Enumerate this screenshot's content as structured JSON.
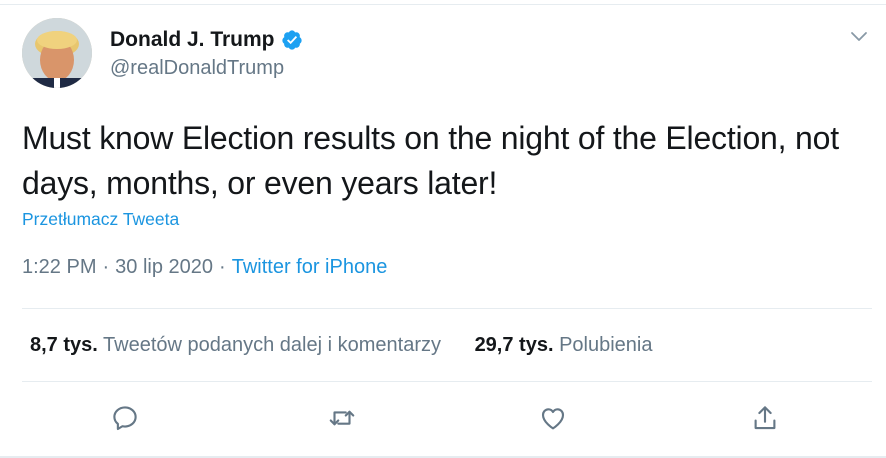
{
  "tweet": {
    "author_name": "Donald J. Trump",
    "author_handle": "@realDonaldTrump",
    "text": "Must know Election results on the night of the Election, not days, months, or even years later!",
    "translate_label": "Przetłumacz Tweeta",
    "time": "1:22 PM",
    "date": "30 lip 2020",
    "separator": "·",
    "source": "Twitter for iPhone",
    "retweets_count": "8,7 tys.",
    "retweets_label": "Tweetów podanych dalej i komentarzy",
    "likes_count": "29,7 tys.",
    "likes_label": "Polubienia"
  },
  "icons": {
    "verified": "verified-badge-icon",
    "more": "chevron-down-icon",
    "reply": "reply-icon",
    "retweet": "retweet-icon",
    "like": "heart-icon",
    "share": "share-icon"
  },
  "colors": {
    "link": "#1b95e0",
    "secondary_text": "#657786",
    "primary_text": "#14171a",
    "divider": "#e6ecf0",
    "verified": "#1da1f2"
  }
}
